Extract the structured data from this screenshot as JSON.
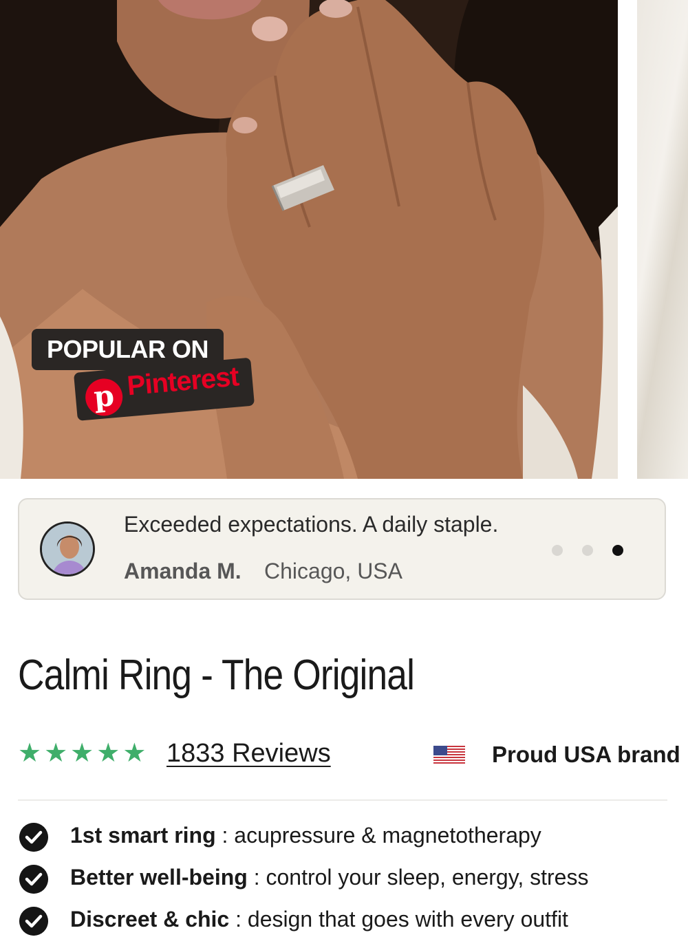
{
  "gallery": {
    "badge_popular": "POPULAR ON",
    "badge_pinterest": "Pinterest",
    "pinterest_logo_letter": "p"
  },
  "review": {
    "quote": "Exceeded expectations. A daily staple.",
    "author": "Amanda M.",
    "location": "Chicago, USA",
    "dots_total": 3,
    "active_dot": 3
  },
  "product": {
    "title": "Calmi Ring - The Original",
    "rating_stars": 5,
    "reviews_label": "1833 Reviews",
    "brand_badge": "Proud USA brand",
    "star_color": "#3fae6a"
  },
  "features": [
    {
      "title": "1st smart ring",
      "separator": " : ",
      "desc": "acupressure & magnetotherapy"
    },
    {
      "title": "Better well-being",
      "separator": " : ",
      "desc": "control your sleep, energy, stress"
    },
    {
      "title": "Discreet & chic",
      "separator": " : ",
      "desc": "design that goes with every outfit"
    }
  ]
}
